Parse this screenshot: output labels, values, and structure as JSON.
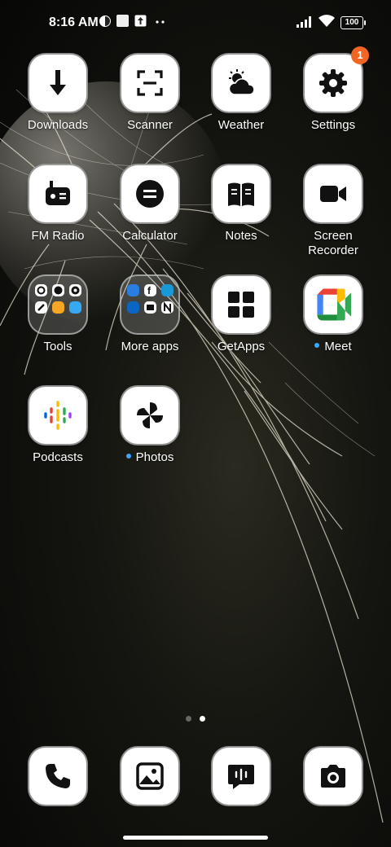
{
  "status_bar": {
    "time": "8:16 AM",
    "battery": "100"
  },
  "apps": [
    {
      "label": "Downloads",
      "icon": "download-icon"
    },
    {
      "label": "Scanner",
      "icon": "scanner-icon"
    },
    {
      "label": "Weather",
      "icon": "weather-icon"
    },
    {
      "label": "Settings",
      "icon": "gear-icon",
      "badge": "1"
    },
    {
      "label": "FM Radio",
      "icon": "radio-icon"
    },
    {
      "label": "Calculator",
      "icon": "calculator-icon"
    },
    {
      "label": "Notes",
      "icon": "book-icon"
    },
    {
      "label": "Screen Recorder",
      "label_line1": "Screen",
      "label_line2": "Recorder",
      "icon": "video-camera-icon"
    },
    {
      "label": "Tools",
      "icon": "folder-icon"
    },
    {
      "label": "More apps",
      "icon": "folder-icon"
    },
    {
      "label": "GetApps",
      "icon": "grid-icon"
    },
    {
      "label": "Meet",
      "icon": "meet-icon",
      "new_dot": true
    },
    {
      "label": "Podcasts",
      "icon": "podcasts-icon"
    },
    {
      "label": "Photos",
      "icon": "pinwheel-icon",
      "new_dot": true
    }
  ],
  "pager": {
    "pages": 2,
    "current": 2
  },
  "dock": [
    {
      "icon": "phone-icon"
    },
    {
      "icon": "gallery-icon"
    },
    {
      "icon": "messages-icon"
    },
    {
      "icon": "camera-icon"
    }
  ],
  "colors": {
    "badge": "#f26522",
    "new_dot": "#3fa5ff",
    "tile": "#ffffff"
  }
}
